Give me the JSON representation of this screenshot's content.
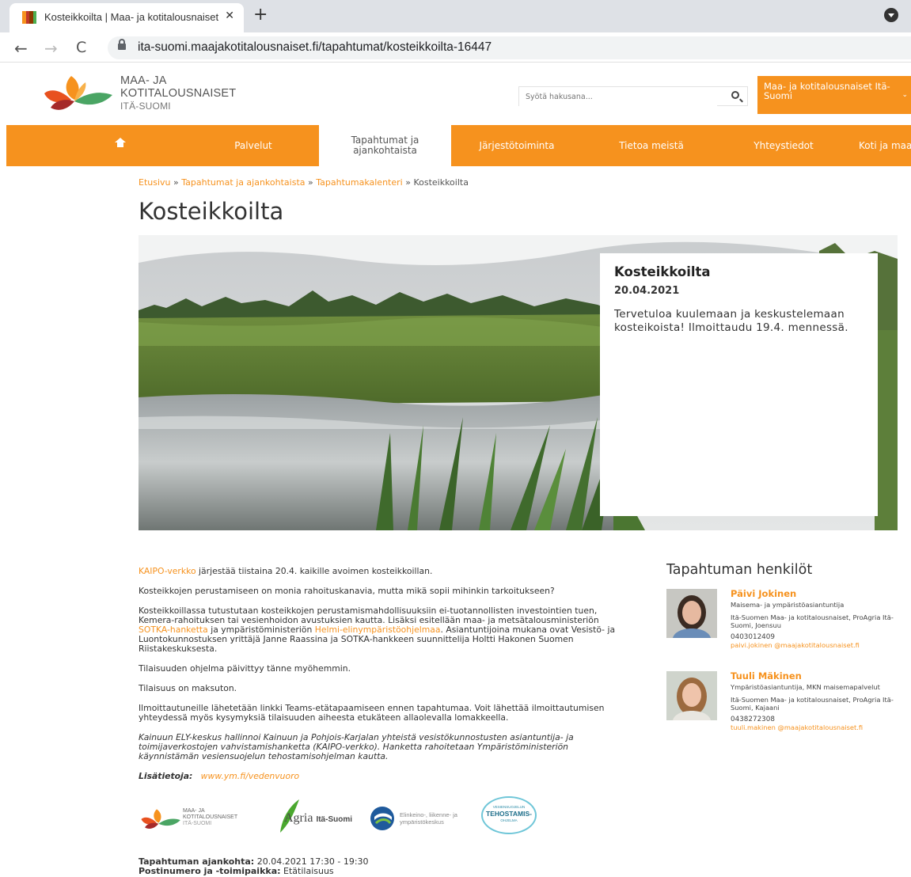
{
  "browser": {
    "tab_title": "Kosteikkoilta | Maa- ja kotitalousnaiset",
    "tab_close": "✕",
    "new_tab": "+",
    "url": "ita-suomi.maajakotitalousnaiset.fi/tapahtumat/kosteikkoilta-16447",
    "back": "←",
    "forward": "→",
    "reload": "C"
  },
  "header": {
    "logo_line1": "MAA- JA",
    "logo_line2": "KOTITALOUSNAISET",
    "logo_line3": "ITÄ-SUOMI",
    "search_placeholder": "Syötä hakusana...",
    "region_label": "Maa- ja kotitalousnaiset Itä-Suomi",
    "region_chevron": "⌄"
  },
  "nav": {
    "items": [
      {
        "label": "Palvelut"
      },
      {
        "label": "Tapahtumat ja ajankohtaista"
      },
      {
        "label": "Järjestötoiminta"
      },
      {
        "label": "Tietoa meistä"
      },
      {
        "label": "Yhteystiedot"
      },
      {
        "label": "Koti ja maa"
      }
    ]
  },
  "breadcrumb": {
    "home": "Etusivu",
    "sep": "»",
    "level2": "Tapahtumat ja ajankohtaista",
    "level3": "Tapahtumakalenteri",
    "current": "Kosteikkoilta"
  },
  "page": {
    "title": "Kosteikkoilta"
  },
  "event_card": {
    "title": "Kosteikkoilta",
    "date": "20.04.2021",
    "description": "Tervetuloa kuulemaan ja keskustelemaan kosteikoista! Ilmoittaudu 19.4. mennessä."
  },
  "body": {
    "p1_link": "KAIPO-verkko",
    "p1_text": " järjestää tiistaina 20.4. kaikille avoimen kosteikkoillan.",
    "p2": "Kosteikkojen perustamiseen on monia rahoituskanavia, mutta mikä sopii mihinkin tarkoitukseen?",
    "p3_a": "Kosteikkoillassa tutustutaan kosteikkojen perustamismahdollisuuksiin ei-tuotannollisten investointien tuen, Kemera-rahoituksen tai vesienhoidon avustuksien kautta. Lisäksi esitellään maa- ja metsätalousministeriön ",
    "p3_link1": "SOTKA-hanketta",
    "p3_b": " ja ympäristöministeriön ",
    "p3_link2": "Helmi-elinympäristöohjelmaa",
    "p3_c": ". Asiantuntijoina mukana ovat Vesistö- ja Luontokunnostuksen yrittäjä Janne Raassina ja SOTKA-hankkeen suunnittelija Holtti Hakonen Suomen Riistakeskuksesta.",
    "p4": "Tilaisuuden ohjelma päivittyy tänne myöhemmin.",
    "p5": "Tilaisuus on maksuton.",
    "p6": "Ilmoittautuneille lähetetään linkki Teams-etätapaamiseen ennen tapahtumaa. Voit lähettää ilmoittautumisen yhteydessä myös kysymyksiä tilaisuuden aiheesta etukäteen allaolevalla lomakkeella.",
    "p7": "Kainuun ELY-keskus hallinnoi Kainuun ja Pohjois-Karjalan yhteistä vesistökunnostusten asiantuntija- ja toimijaverkostojen vahvistamishanketta (KAIPO-verkko). Hanketta rahoitetaan Ympäristöministeriön käynnistämän vesiensuojelun tehostamisohjelman kautta.",
    "more_label": "Lisätietoja:",
    "more_link": "www.ym.fi/vedenvuoro"
  },
  "partners": {
    "mkn_line1": "MAA- JA",
    "mkn_line2": "KOTITALOUSNAISET",
    "mkn_line3": "ITÄ-SUOMI",
    "agria": "Agria",
    "agria_region": "Itä-Suomi",
    "ely_line1": "Elinkeino-, liikenne- ja",
    "ely_line2": "ympäristökeskus",
    "teho_line1": "VESIENSUOJELUN",
    "teho_line2": "TEHOSTAMIS-",
    "teho_line3": "OHJELMA"
  },
  "event_meta": {
    "time_label": "Tapahtuman ajankohta:",
    "time_value": " 20.04.2021 17:30 - 19:30",
    "place_label": "Postinumero ja -toimipaikka:",
    "place_value": " Etätilaisuus"
  },
  "people": {
    "heading": "Tapahtuman henkilöt",
    "list": [
      {
        "name": "Päivi Jokinen",
        "role": "Maisema- ja ympäristöasiantuntija",
        "org": "Itä-Suomen Maa- ja kotitalousnaiset, ProAgria Itä-Suomi, Joensuu",
        "phone": "0403012409",
        "email": "paivi.jokinen @maajakotitalousnaiset.fi"
      },
      {
        "name": "Tuuli Mäkinen",
        "role": "Ympäristöasiantuntija, MKN maisemapalvelut",
        "org": "Itä-Suomen Maa- ja kotitalousnaiset, ProAgria Itä-Suomi, Kajaani",
        "phone": "0438272308",
        "email": "tuuli.makinen @maajakotitalousnaiset.fi"
      }
    ]
  },
  "colors": {
    "brand_orange": "#f6921e"
  }
}
